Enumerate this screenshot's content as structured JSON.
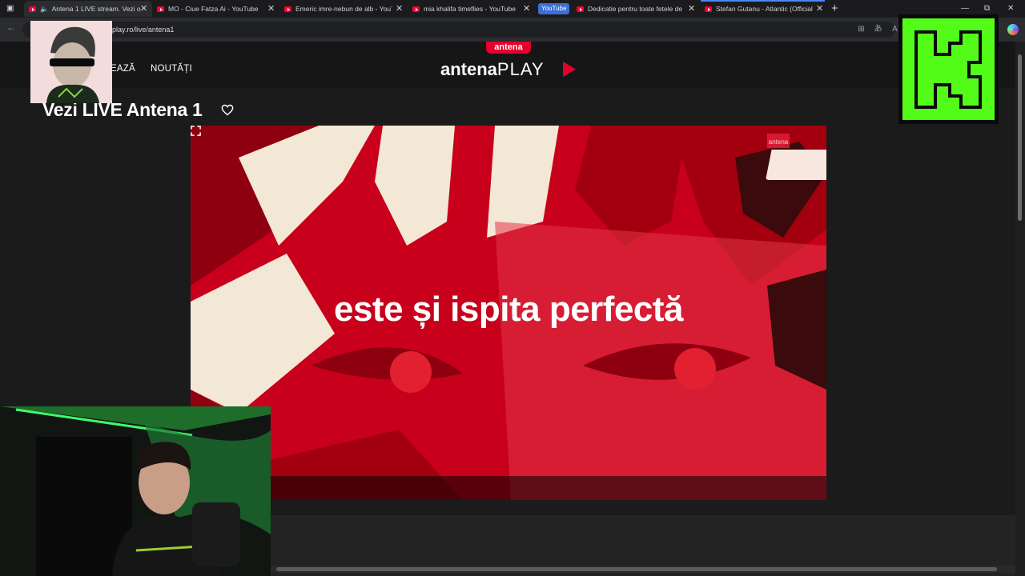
{
  "browser": {
    "tabs": [
      {
        "title": "Antena 1 LIVE stream. Vezi o",
        "active": true
      },
      {
        "title": "MO - Ciue Fatza Ai - YouTube",
        "active": false
      },
      {
        "title": "Emeric imre-nebun de alb - YouT",
        "active": false
      },
      {
        "title": "mia khalifa timeflies - YouTube",
        "active": false
      },
      {
        "title": "Dedicatie pentru toate fetele de",
        "active": false
      },
      {
        "title": "Stefan Gutanu - Atlantic (Official",
        "active": false
      }
    ],
    "youtube_chip": "YouTube",
    "url": "play.ro/live/antena1"
  },
  "site": {
    "nav": {
      "item_1": "EAZĂ",
      "item_2": "NOUTĂȚI"
    },
    "badge": "antena",
    "logo_word": "antena",
    "logo_play": "PLAY",
    "page_title": "Vezi LIVE Antena 1",
    "brand_color": "#e4002b"
  },
  "player": {
    "caption": "este și ispita perfectă",
    "watermark": "antena"
  }
}
